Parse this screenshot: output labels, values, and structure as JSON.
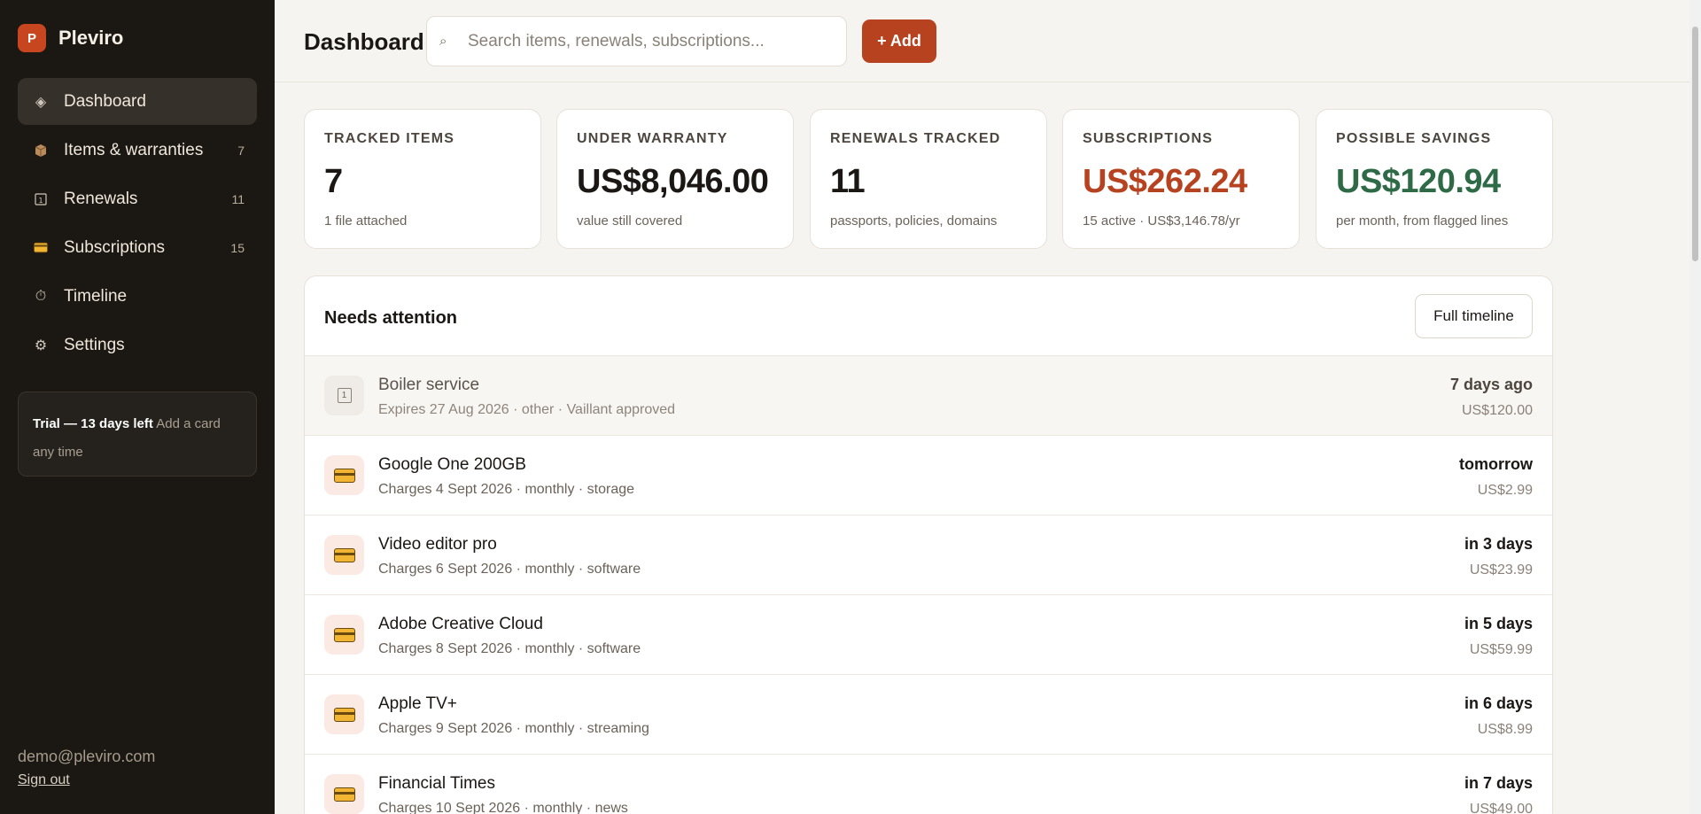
{
  "brand": {
    "logo_letter": "P",
    "name": "Pleviro"
  },
  "sidebar": {
    "items": [
      {
        "label": "Dashboard",
        "icon": "diamond-icon",
        "count": ""
      },
      {
        "label": "Items & warranties",
        "icon": "box-icon",
        "count": "7"
      },
      {
        "label": "Renewals",
        "icon": "calendar-icon",
        "count": "11"
      },
      {
        "label": "Subscriptions",
        "icon": "credit-card-icon",
        "count": "15"
      },
      {
        "label": "Timeline",
        "icon": "stopwatch-icon",
        "count": ""
      },
      {
        "label": "Settings",
        "icon": "gear-icon",
        "count": ""
      }
    ],
    "trial": {
      "strong": "Trial — 13 days left",
      "sub": "Add a card any time"
    },
    "user_email": "demo@pleviro.com",
    "signout_label": "Sign out"
  },
  "header": {
    "title": "Dashboard",
    "search_placeholder": "Search items, renewals, subscriptions...",
    "add_label": "+ Add"
  },
  "stats": [
    {
      "label": "TRACKED ITEMS",
      "value": "7",
      "sub": "1 file attached",
      "color": "#1a1714"
    },
    {
      "label": "UNDER WARRANTY",
      "value": "US$8,046.00",
      "sub": "value still covered",
      "color": "#1a1714"
    },
    {
      "label": "RENEWALS TRACKED",
      "value": "11",
      "sub": "passports, policies, domains",
      "color": "#1a1714"
    },
    {
      "label": "SUBSCRIPTIONS",
      "value": "US$262.24",
      "sub": "15 active · US$3,146.78/yr",
      "color": "#b6421f"
    },
    {
      "label": "POSSIBLE SAVINGS",
      "value": "US$120.94",
      "sub": "per month, from flagged lines",
      "color": "#2e6a46"
    }
  ],
  "attention": {
    "title": "Needs attention",
    "timeline_button": "Full timeline",
    "rows": [
      {
        "title": "Boiler service",
        "sub": "Expires 27 Aug 2026 · other · Vaillant approved",
        "when": "7 days ago",
        "amount": "US$120.00",
        "icon": "calendar-icon",
        "muted": true
      },
      {
        "title": "Google One 200GB",
        "sub": "Charges 4 Sept 2026 · monthly · storage",
        "when": "tomorrow",
        "amount": "US$2.99",
        "icon": "credit-card-icon",
        "muted": false
      },
      {
        "title": "Video editor pro",
        "sub": "Charges 6 Sept 2026 · monthly · software",
        "when": "in 3 days",
        "amount": "US$23.99",
        "icon": "credit-card-icon",
        "muted": false
      },
      {
        "title": "Adobe Creative Cloud",
        "sub": "Charges 8 Sept 2026 · monthly · software",
        "when": "in 5 days",
        "amount": "US$59.99",
        "icon": "credit-card-icon",
        "muted": false
      },
      {
        "title": "Apple TV+",
        "sub": "Charges 9 Sept 2026 · monthly · streaming",
        "when": "in 6 days",
        "amount": "US$8.99",
        "icon": "credit-card-icon",
        "muted": false
      },
      {
        "title": "Financial Times",
        "sub": "Charges 10 Sept 2026 · monthly · news",
        "when": "in 7 days",
        "amount": "US$49.00",
        "icon": "credit-card-icon",
        "muted": false
      }
    ]
  }
}
